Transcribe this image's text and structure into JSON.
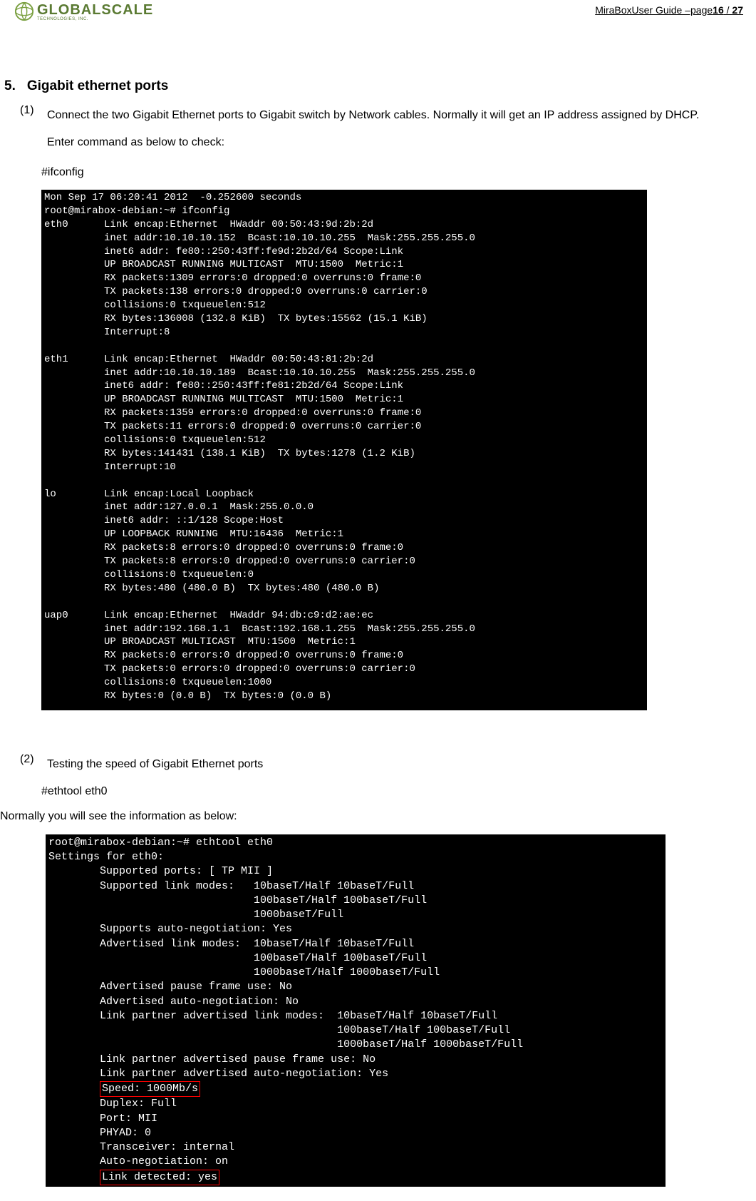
{
  "header": {
    "logo_brand": "GLOBALSCALE",
    "logo_sub": "TECHNOLOGIES, INC.",
    "page_label_prefix": "MiraBoxUser Guide –page",
    "page_current": "16",
    "page_sep": " / ",
    "page_total": "27"
  },
  "section": {
    "number": "5.",
    "title": "Gigabit ethernet ports"
  },
  "step1": {
    "num": "(1)",
    "text": "Connect the two Gigabit Ethernet ports to Gigabit switch by Network cables. Normally it will get an IP address assigned by DHCP.",
    "text2": "Enter command as below to check:",
    "cmd": "#ifconfig"
  },
  "terminal1": {
    "lines": [
      "Mon Sep 17 06:20:41 2012  -0.252600 seconds",
      "root@mirabox-debian:~# ifconfig",
      "eth0      Link encap:Ethernet  HWaddr 00:50:43:9d:2b:2d",
      "          inet addr:10.10.10.152  Bcast:10.10.10.255  Mask:255.255.255.0",
      "          inet6 addr: fe80::250:43ff:fe9d:2b2d/64 Scope:Link",
      "          UP BROADCAST RUNNING MULTICAST  MTU:1500  Metric:1",
      "          RX packets:1309 errors:0 dropped:0 overruns:0 frame:0",
      "          TX packets:138 errors:0 dropped:0 overruns:0 carrier:0",
      "          collisions:0 txqueuelen:512",
      "          RX bytes:136008 (132.8 KiB)  TX bytes:15562 (15.1 KiB)",
      "          Interrupt:8",
      "",
      "eth1      Link encap:Ethernet  HWaddr 00:50:43:81:2b:2d",
      "          inet addr:10.10.10.189  Bcast:10.10.10.255  Mask:255.255.255.0",
      "          inet6 addr: fe80::250:43ff:fe81:2b2d/64 Scope:Link",
      "          UP BROADCAST RUNNING MULTICAST  MTU:1500  Metric:1",
      "          RX packets:1359 errors:0 dropped:0 overruns:0 frame:0",
      "          TX packets:11 errors:0 dropped:0 overruns:0 carrier:0",
      "          collisions:0 txqueuelen:512",
      "          RX bytes:141431 (138.1 KiB)  TX bytes:1278 (1.2 KiB)",
      "          Interrupt:10",
      "",
      "lo        Link encap:Local Loopback",
      "          inet addr:127.0.0.1  Mask:255.0.0.0",
      "          inet6 addr: ::1/128 Scope:Host",
      "          UP LOOPBACK RUNNING  MTU:16436  Metric:1",
      "          RX packets:8 errors:0 dropped:0 overruns:0 frame:0",
      "          TX packets:8 errors:0 dropped:0 overruns:0 carrier:0",
      "          collisions:0 txqueuelen:0",
      "          RX bytes:480 (480.0 B)  TX bytes:480 (480.0 B)",
      "",
      "uap0      Link encap:Ethernet  HWaddr 94:db:c9:d2:ae:ec",
      "          inet addr:192.168.1.1  Bcast:192.168.1.255  Mask:255.255.255.0",
      "          UP BROADCAST MULTICAST  MTU:1500  Metric:1",
      "          RX packets:0 errors:0 dropped:0 overruns:0 frame:0",
      "          TX packets:0 errors:0 dropped:0 overruns:0 carrier:0",
      "          collisions:0 txqueuelen:1000",
      "          RX bytes:0 (0.0 B)  TX bytes:0 (0.0 B)"
    ]
  },
  "step2": {
    "num": "(2)",
    "text": "Testing the speed of Gigabit Ethernet ports",
    "cmd": "#ethtool eth0"
  },
  "normally": "Normally you will see the information as below:",
  "terminal2": {
    "lines": [
      "root@mirabox-debian:~# ethtool eth0",
      "Settings for eth0:",
      "        Supported ports: [ TP MII ]",
      "        Supported link modes:   10baseT/Half 10baseT/Full",
      "                                100baseT/Half 100baseT/Full",
      "                                1000baseT/Full",
      "        Supports auto-negotiation: Yes",
      "        Advertised link modes:  10baseT/Half 10baseT/Full",
      "                                100baseT/Half 100baseT/Full",
      "                                1000baseT/Half 1000baseT/Full",
      "        Advertised pause frame use: No",
      "        Advertised auto-negotiation: No",
      "        Link partner advertised link modes:  10baseT/Half 10baseT/Full",
      "                                             100baseT/Half 100baseT/Full",
      "                                             1000baseT/Half 1000baseT/Full",
      "        Link partner advertised pause frame use: No",
      "        Link partner advertised auto-negotiation: Yes"
    ],
    "speed_prefix": "        ",
    "speed_box": "Speed: 1000Mb/s",
    "after_speed": [
      "        Duplex: Full",
      "        Port: MII",
      "        PHYAD: 0",
      "        Transceiver: internal",
      "        Auto-negotiation: on"
    ],
    "link_prefix": "        ",
    "link_box": "Link detected: yes"
  }
}
